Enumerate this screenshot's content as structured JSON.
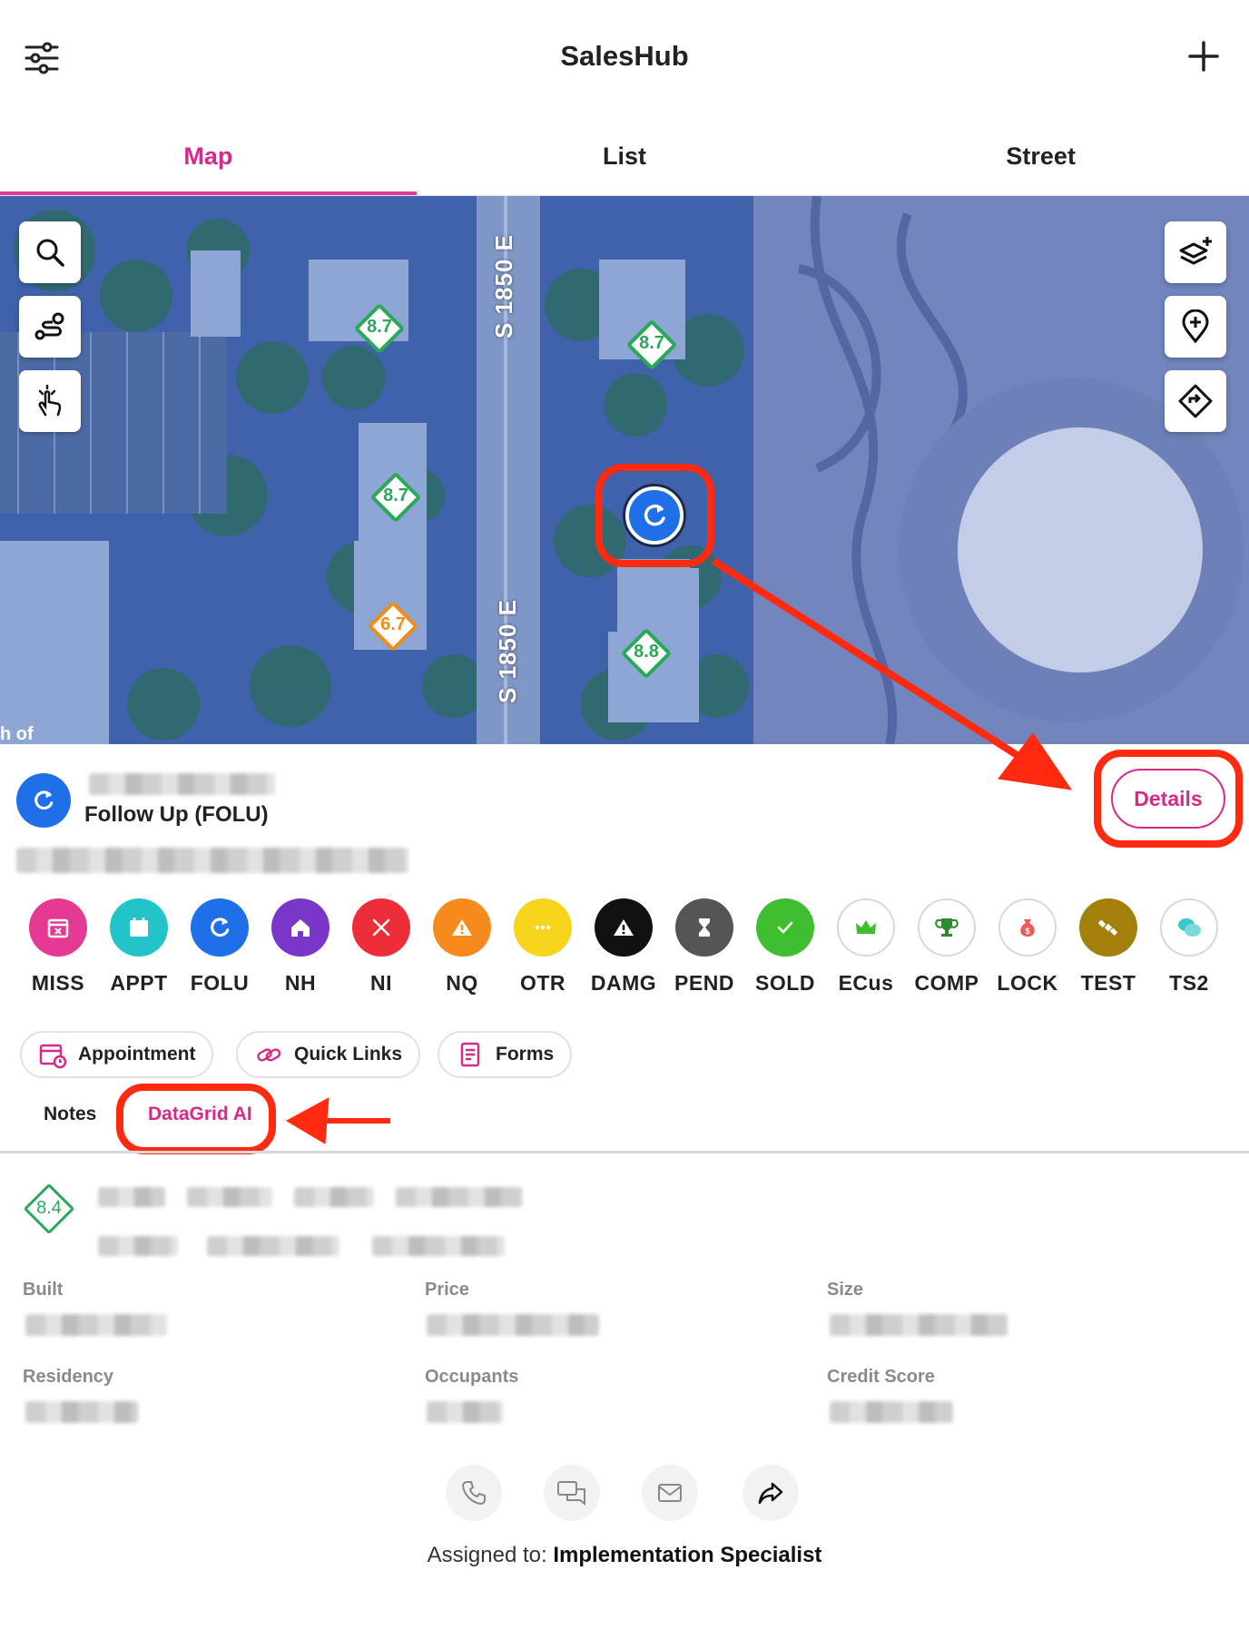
{
  "header": {
    "title": "SalesHub"
  },
  "tabs": [
    {
      "label": "Map"
    },
    {
      "label": "List"
    },
    {
      "label": "Street"
    }
  ],
  "map": {
    "road_label_1": "S 1850 E",
    "road_label_2": "S 1850 E",
    "corner_text": "h of",
    "pins": [
      {
        "value": "8.7",
        "color": "green"
      },
      {
        "value": "8.7",
        "color": "green"
      },
      {
        "value": "8.7",
        "color": "green"
      },
      {
        "value": "6.7",
        "color": "orange"
      },
      {
        "value": "8.8",
        "color": "green"
      }
    ]
  },
  "lead": {
    "status": "Follow Up (FOLU)",
    "details_label": "Details"
  },
  "statuses": [
    {
      "label": "MISS",
      "color": "#e53a93",
      "icon": "calendar-x-icon"
    },
    {
      "label": "APPT",
      "color": "#22c3c9",
      "icon": "calendar-icon"
    },
    {
      "label": "FOLU",
      "color": "#1e6fe8",
      "icon": "refresh-icon"
    },
    {
      "label": "NH",
      "color": "#7a35c9",
      "icon": "home-icon"
    },
    {
      "label": "NI",
      "color": "#ee2d3a",
      "icon": "x-icon"
    },
    {
      "label": "NQ",
      "color": "#f78a1d",
      "icon": "warning-icon"
    },
    {
      "label": "OTR",
      "color": "#f7d51d",
      "icon": "ellipsis-icon"
    },
    {
      "label": "DAMG",
      "color": "#111111",
      "icon": "warning-icon"
    },
    {
      "label": "PEND",
      "color": "#555555",
      "icon": "hourglass-icon"
    },
    {
      "label": "SOLD",
      "color": "#3fbf2f",
      "icon": "check-icon"
    },
    {
      "label": "ECus",
      "color": "#ffffff",
      "icon": "crown-icon"
    },
    {
      "label": "COMP",
      "color": "#ffffff",
      "icon": "trophy-icon"
    },
    {
      "label": "LOCK",
      "color": "#ffffff",
      "icon": "money-bag-icon"
    },
    {
      "label": "TEST",
      "color": "#a3800c",
      "icon": "satellite-icon"
    },
    {
      "label": "TS2",
      "color": "#ffffff",
      "icon": "chat-icon"
    }
  ],
  "actions": {
    "appointment": "Appointment",
    "quick_links": "Quick Links",
    "forms": "Forms"
  },
  "subtabs": {
    "notes": "Notes",
    "datagrid": "DataGrid AI"
  },
  "property": {
    "score": "8.4",
    "labels": {
      "built": "Built",
      "price": "Price",
      "size": "Size",
      "residency": "Residency",
      "occupants": "Occupants",
      "credit_score": "Credit Score"
    }
  },
  "assigned": {
    "prefix": "Assigned to: ",
    "name": "Implementation Specialist"
  },
  "colors": {
    "accent": "#d6298a",
    "callout": "#ff2a10"
  }
}
